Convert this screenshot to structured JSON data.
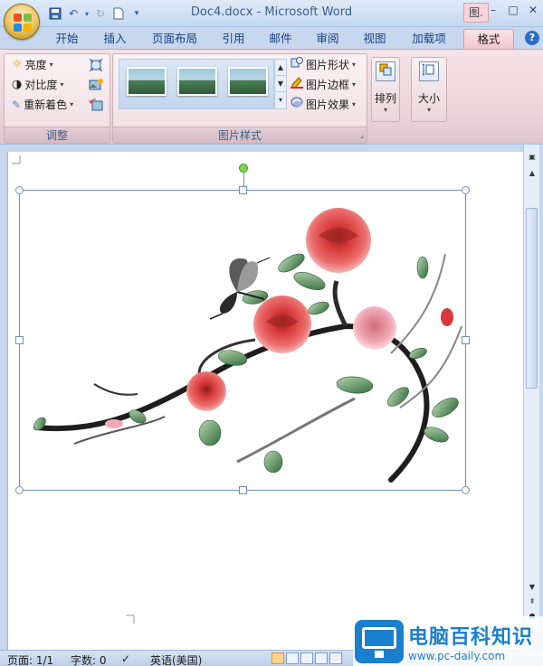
{
  "window": {
    "title": "Doc4.docx - Microsoft Word",
    "context_label": "图.",
    "controls": [
      "–",
      "□",
      "✕"
    ]
  },
  "qat": {
    "undo_label": "↶",
    "redo_label": "↻"
  },
  "tabs": [
    {
      "label": "开始"
    },
    {
      "label": "插入"
    },
    {
      "label": "页面布局"
    },
    {
      "label": "引用"
    },
    {
      "label": "邮件"
    },
    {
      "label": "审阅"
    },
    {
      "label": "视图"
    },
    {
      "label": "加载项"
    },
    {
      "label": "格式",
      "active": true
    }
  ],
  "ribbon": {
    "adjust": {
      "label": "调整",
      "brightness": "亮度",
      "contrast": "对比度",
      "recolor": "重新着色"
    },
    "picture_styles": {
      "label": "图片样式",
      "shape": "图片形状",
      "border": "图片边框",
      "effects": "图片效果"
    },
    "arrange": {
      "label": "排列"
    },
    "size": {
      "label": "大小"
    }
  },
  "statusbar": {
    "page": "页面: 1/1",
    "words": "字数: 0",
    "language": "英语(美国)"
  },
  "watermark": {
    "title": "电脑百科知识",
    "url": "www.pc-daily.com"
  },
  "colors": {
    "accent": "#15428b",
    "context_tab": "#f1c7cf",
    "rose": "#d9363e",
    "watermark_blue": "#1b7fd0"
  }
}
